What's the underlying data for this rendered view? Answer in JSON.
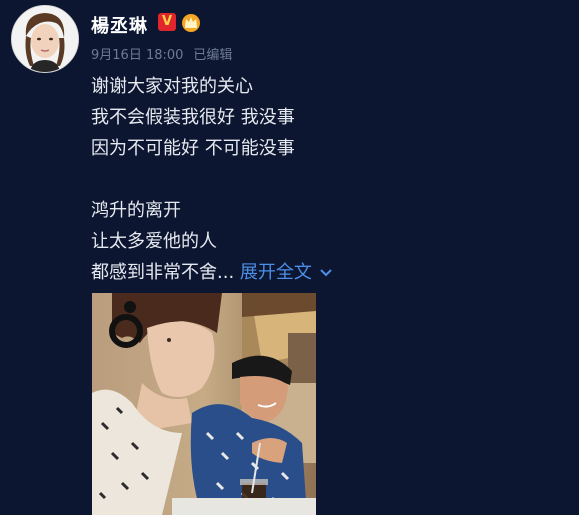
{
  "post": {
    "author_name": "楊丞琳",
    "verified_icon": "verified-v-icon",
    "verified_label": "V",
    "vip_icon": "vip-crown-icon",
    "date": "9月16日 18:00",
    "edited_label": "已编辑",
    "lines": [
      "谢谢大家对我的关心",
      "我不会假装我很好 我没事",
      "因为不可能好 不可能没事",
      "",
      "鸿升的离开",
      "让太多爱他的人",
      "都感到非常不舍..."
    ],
    "expand_label": "展开全文",
    "expand_icon": "chevron-down-icon",
    "photo_icon": "photo-thumbnail"
  },
  "colors": {
    "background": "#0c1630",
    "text": "#e6e9f0",
    "meta": "#6f7b96",
    "link": "#4d8fe8",
    "verified": "#e0262c"
  }
}
